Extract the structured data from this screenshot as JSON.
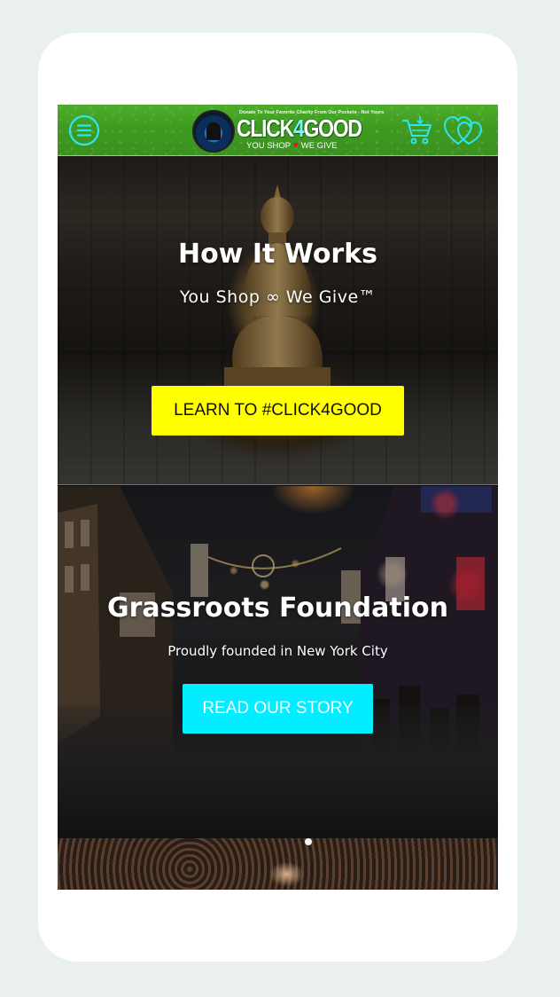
{
  "header": {
    "logo_tagline": "Donate To Your Favorite Charity From Our Pockets - Not Yours",
    "logo_word_main": "CLICK",
    "logo_word_four": "4",
    "logo_word_end": "GOOD",
    "logo_sub_left": "YOU SHOP",
    "logo_sub_right": "WE GIVE",
    "accent_color": "#3f9a20",
    "icon_color": "#2ee6f0",
    "icons": [
      "menu-icon",
      "cart-icon",
      "hearts-icon"
    ]
  },
  "slides": [
    {
      "title": "How It Works",
      "subtitle": "You Shop ∞ We Give™",
      "button_label": "LEARN TO #CLICK4GOOD",
      "button_color": "#ffff00"
    },
    {
      "title": "Grassroots Foundation",
      "subtitle": "Proudly founded in New York City",
      "button_label": "READ OUR STORY",
      "button_color": "#00eeff"
    }
  ]
}
